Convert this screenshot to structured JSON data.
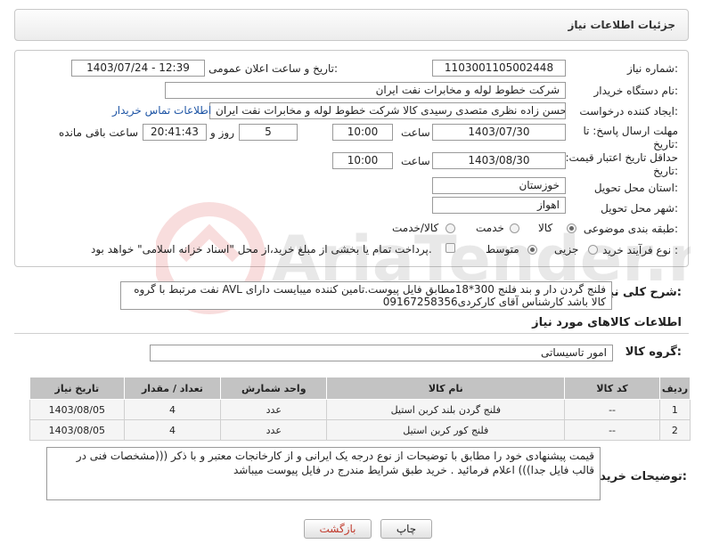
{
  "header": {
    "title": "جزئیات اطلاعات نیاز"
  },
  "form": {
    "need_number_label": "شماره نیاز:",
    "need_number": "1103001105002448",
    "announce_label": "تاریخ و ساعت اعلان عمومی:",
    "announce_value": "1403/07/24 - 12:39",
    "buyer_org_label": "نام دستگاه خریدار:",
    "buyer_org": "شرکت خطوط لوله و مخابرات نفت ایران",
    "creator_label": "ایجاد کننده درخواست:",
    "creator": "محسن زاده نظری متصدی رسیدی کالا شرکت خطوط لوله و مخابرات نفت ایران",
    "contact_link": "اطلاعات تماس خریدار",
    "deadline_label_1": "مهلت ارسال پاسخ: تا",
    "deadline_label_2": "تاریخ:",
    "deadline_date": "1403/07/30",
    "time_label": "ساعت",
    "deadline_time": "10:00",
    "days_count": "5",
    "days_label": "روز و",
    "remaining_time": "20:41:43",
    "remaining_label": "ساعت باقی مانده",
    "validity_label_1": "حداقل تاریخ اعتبار قیمت: تا",
    "validity_label_2": "تاریخ:",
    "validity_date": "1403/08/30",
    "validity_time": "10:00",
    "province_label": "استان محل تحویل:",
    "province": "خوزستان",
    "city_label": "شهر محل تحویل:",
    "city": "اهواز",
    "category_label": "طبقه بندی موضوعی:",
    "category_options": [
      "کالا",
      "خدمت",
      "کالا/خدمت"
    ],
    "process_label": "نوع فرآیند خرید :",
    "process_options": [
      "جزیی",
      "متوسط"
    ],
    "payment_note": "پرداخت تمام یا بخشی از مبلغ خرید،از محل \"اسناد خزانه اسلامی\" خواهد بود."
  },
  "description": {
    "label": "شرح کلی نیاز:",
    "text": "فلنج گردن دار و بند فلنج 300*18مطابق فایل پیوست.تامین کننده میبایست دارای AVL نفت مرتبط با گروه کالا باشد  کارشناس آقای کارکردی09167258356"
  },
  "goods": {
    "section_title": "اطلاعات کالاهای مورد نیاز",
    "group_label": "گروه کالا:",
    "group_value": "امور تاسیساتی",
    "columns": [
      "ردیف",
      "کد کالا",
      "نام کالا",
      "واحد شمارش",
      "تعداد / مقدار",
      "تاریخ نیاز"
    ],
    "rows": [
      [
        "1",
        "--",
        "فلنج گردن بلند کربن استیل",
        "عدد",
        "4",
        "1403/08/05"
      ],
      [
        "2",
        "--",
        "فلنج کور کربن استیل",
        "عدد",
        "4",
        "1403/08/05"
      ]
    ]
  },
  "buyer_notes": {
    "label": "توضیحات خریدار:",
    "text": "قیمت پیشنهادی خود را مطابق با توضیحات از نوع درجه یک ایرانی و از کارخانجات معتبر و با ذکر (((مشخصات فنی در قالب فایل جدا))) اعلام فرمائید . خرید طبق شرایط مندرج در فایل پیوست میباشد"
  },
  "buttons": {
    "print": "چاپ",
    "back": "بازگشت"
  },
  "colors": {
    "back_text": "#c0392b",
    "link": "#1e55a5"
  }
}
